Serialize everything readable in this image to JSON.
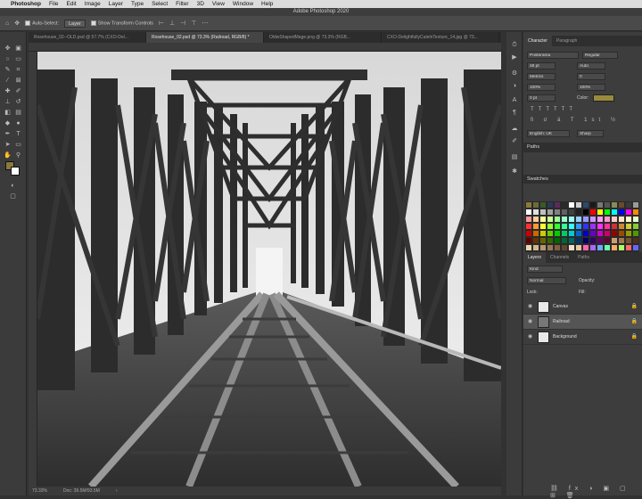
{
  "menubar": {
    "apple_icon": "apple-logo-icon",
    "items": [
      "Photoshop",
      "File",
      "Edit",
      "Image",
      "Layer",
      "Type",
      "Select",
      "Filter",
      "3D",
      "View",
      "Window",
      "Help"
    ]
  },
  "window": {
    "title": "Adobe Photoshop 2020"
  },
  "options": {
    "auto_select_label": "Auto-Select:",
    "auto_select_value": "Layer",
    "transform_label": "Show Transform Controls"
  },
  "tabs": [
    {
      "label": "Rosehouse_02--OLD.psd @ 57.7% (CXO-Del..."
    },
    {
      "label": "Rosehouse_02.psd @ 73.3% (Railroad, RGB/8) *"
    },
    {
      "label": "OldwShapedMage.png @ 73.3% (RGB..."
    },
    {
      "label": "CXO-DelightfullyCutelnTexture_14.jpg @ 73..."
    }
  ],
  "status": {
    "zoom": "73.33%",
    "doc": "Doc: 39.5M/93.5M"
  },
  "panels": {
    "char_tabs": [
      "Character",
      "Paragraph"
    ],
    "font_family": "Posterama",
    "font_style": "Regular",
    "font_size": "48 pt",
    "leading": "Auto",
    "tracking": "Metrics",
    "kerning": "0",
    "vscale": "100%",
    "hscale": "100%",
    "baseline": "0 pt",
    "color_label": "Color:",
    "language": "English: UK",
    "aa": "Sharp",
    "paths_label": "Paths",
    "swatches_label": "Swatches",
    "layers_tabs": [
      "Layers",
      "Channels",
      "Paths"
    ],
    "layer_search": "Kind",
    "blend_mode": "Normal",
    "opacity_label": "Opacity:",
    "lock_label": "Lock:",
    "fill_label": "Fill:",
    "layers": [
      {
        "name": "Canvas",
        "selected": false
      },
      {
        "name": "Railroad",
        "selected": true
      },
      {
        "name": "Background",
        "selected": false
      }
    ]
  },
  "colors": {
    "foreground": "#8a7a3a",
    "background": "#ffffff",
    "text_color": "#9a8a3c"
  }
}
